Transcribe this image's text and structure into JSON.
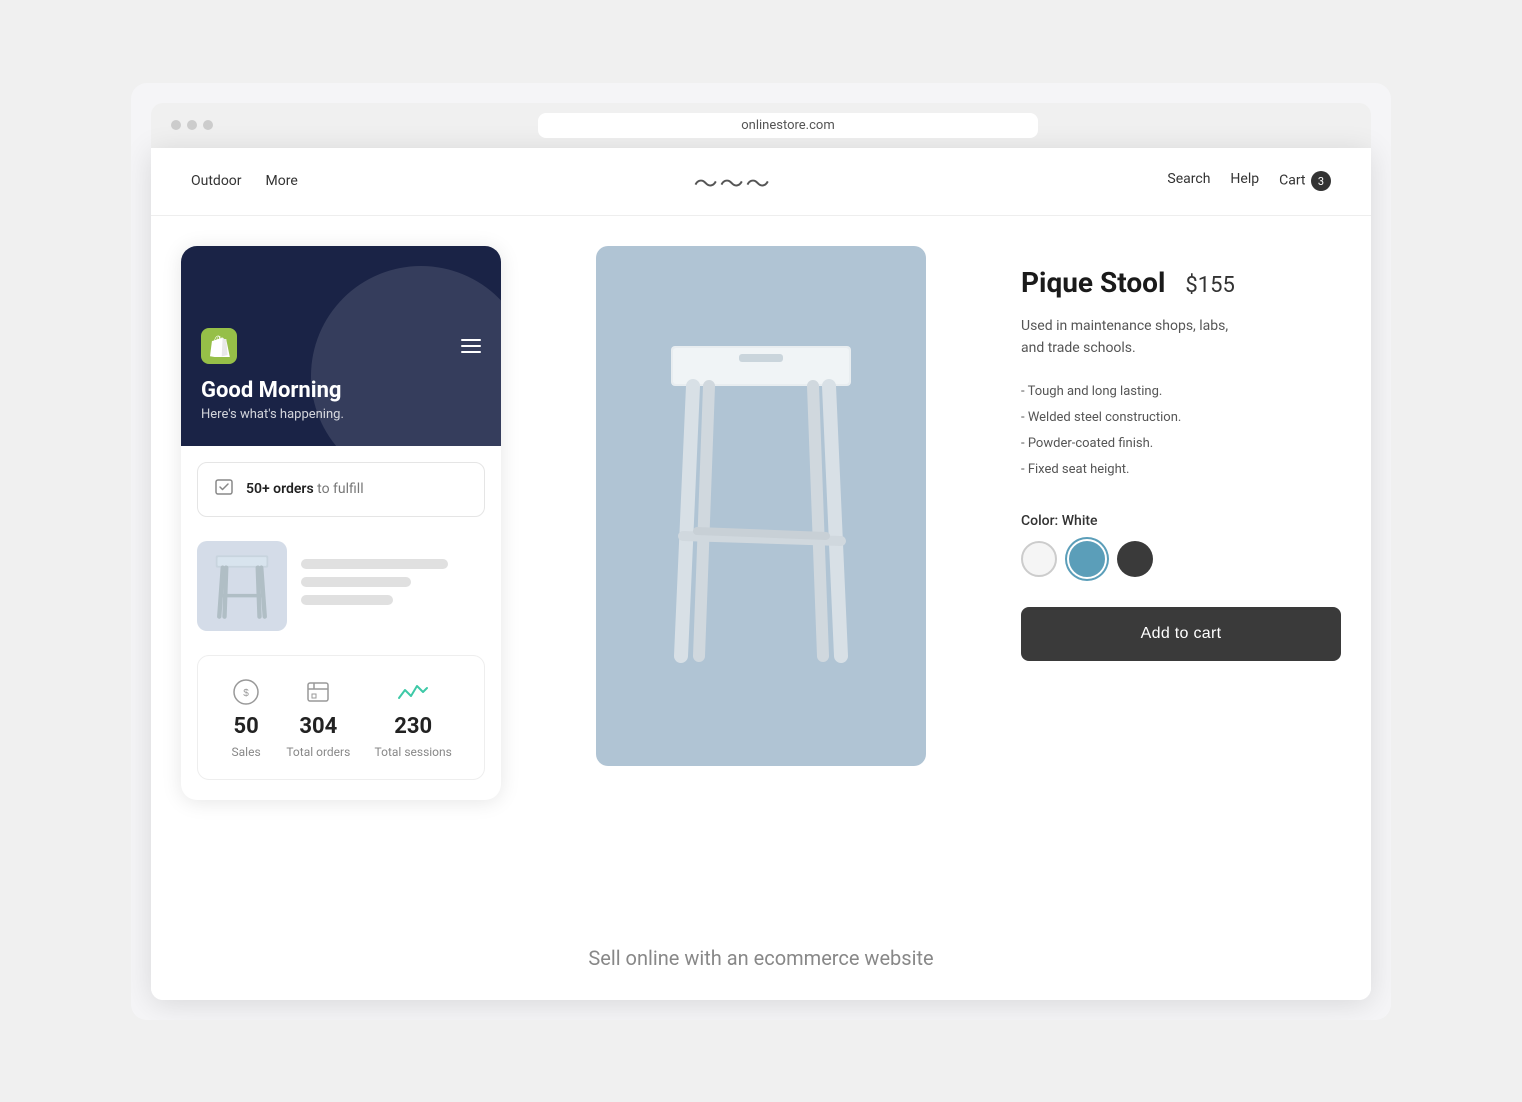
{
  "browser": {
    "dots": [
      "dot1",
      "dot2",
      "dot3"
    ],
    "url": "onlinestore.com"
  },
  "store_nav": {
    "left_links": [
      "Outdoor",
      "More"
    ],
    "logo_wave": "∿∿∿",
    "right_links": [
      "Search",
      "Help",
      "Cart"
    ],
    "cart_count": "3"
  },
  "shopify_admin": {
    "logo_alt": "Shopify",
    "menu_icon_alt": "Menu",
    "greeting_title": "Good Morning",
    "greeting_subtitle": "Here's what's happening.",
    "orders_bar": {
      "count_text": "50+ orders",
      "label_text": "to fulfill"
    },
    "stats": [
      {
        "icon": "dollar-circle",
        "value": "50",
        "label": "Sales"
      },
      {
        "icon": "orders",
        "value": "304",
        "label": "Total orders"
      },
      {
        "icon": "sessions",
        "value": "230",
        "label": "Total sessions"
      }
    ]
  },
  "product": {
    "name": "Pique Stool",
    "price": "$155",
    "description": "Used in maintenance shops, labs,\nand trade schools.",
    "features": [
      "- Tough and long lasting.",
      "- Welded steel construction.",
      "- Powder-coated finish.",
      "- Fixed seat height."
    ],
    "color_label": "Color: White",
    "colors": [
      "White",
      "Blue",
      "Dark"
    ],
    "add_to_cart_label": "Add to cart"
  },
  "bottom": {
    "tagline": "Sell online with an ecommerce website"
  }
}
